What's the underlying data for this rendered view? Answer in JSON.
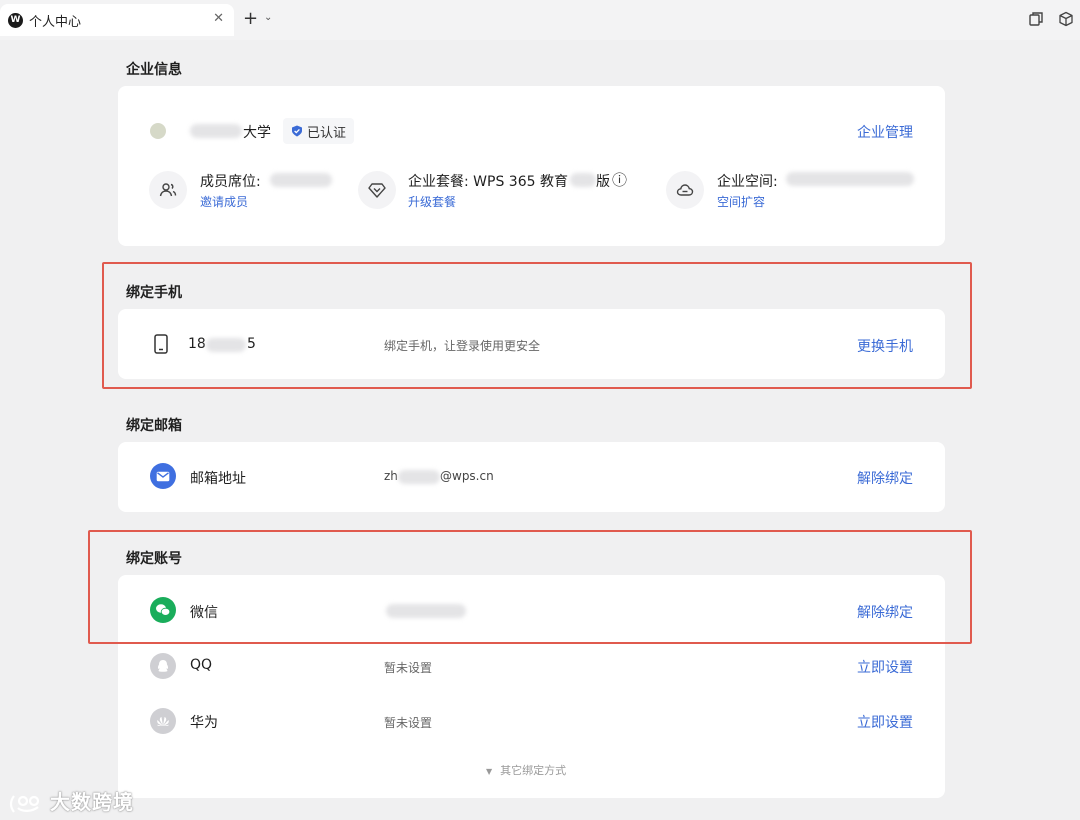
{
  "tab": {
    "logo": "W",
    "title": "个人中心",
    "close": "✕",
    "new_tab": "+",
    "caret": "⌄"
  },
  "enterprise": {
    "section_title": "企业信息",
    "name_suffix": "大学",
    "verified": "已认证",
    "manage": "企业管理",
    "seats_label": "成员席位:",
    "seats_link": "邀请成员",
    "package_label": "企业套餐: WPS 365 教育",
    "package_suffix": "版",
    "package_info_icon": "ⓘ",
    "package_link": "升级套餐",
    "space_label": "企业空间:",
    "space_link": "空间扩容"
  },
  "phone": {
    "section_title": "绑定手机",
    "number_prefix": "18",
    "number_suffix": "5",
    "hint": "绑定手机，让登录使用更安全",
    "action": "更换手机"
  },
  "email": {
    "section_title": "绑定邮箱",
    "label": "邮箱地址",
    "addr_prefix": "zh",
    "addr_suffix": "@wps.cn",
    "action": "解除绑定"
  },
  "accounts": {
    "section_title": "绑定账号",
    "items": [
      {
        "name": "微信",
        "status": "",
        "action": "解除绑定",
        "icon": "wechat-icon",
        "color": "#1aad5b"
      },
      {
        "name": "QQ",
        "status": "暂未设置",
        "action": "立即设置",
        "icon": "qq-icon",
        "color": "#cfcfd3"
      },
      {
        "name": "华为",
        "status": "暂未设置",
        "action": "立即设置",
        "icon": "huawei-icon",
        "color": "#cfcfd3"
      }
    ],
    "more": "其它绑定方式",
    "more_arrow": "▼"
  },
  "watermark": "大数跨境",
  "colors": {
    "accent": "#3b6bd6",
    "highlight": "#e05a4e",
    "wechat": "#1aad5b",
    "email": "#3f6fe0"
  }
}
